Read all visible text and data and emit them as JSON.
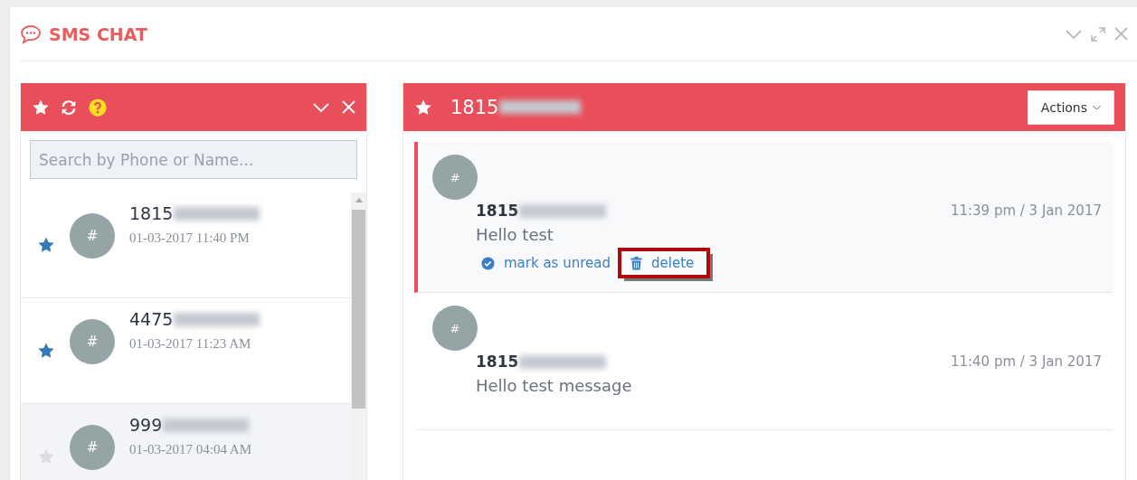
{
  "window": {
    "title": "SMS CHAT"
  },
  "contacts_panel": {
    "search": {
      "placeholder": "Search by Phone or Name..."
    },
    "conversations": [
      {
        "avatar": "#",
        "number": "1815",
        "time": "01-03-2017 11:40 PM",
        "starred": true,
        "selected": false
      },
      {
        "avatar": "#",
        "number": "4475",
        "time": "01-03-2017 11:23 AM",
        "starred": true,
        "selected": false
      },
      {
        "avatar": "#",
        "number": "999",
        "time": "01-03-2017 04:04 AM",
        "starred": false,
        "selected": true
      }
    ]
  },
  "chat_panel": {
    "number": "1815",
    "actions_button": "Actions",
    "messages": [
      {
        "avatar": "#",
        "sender": "1815",
        "time": "11:39 pm / 3 Jan 2017",
        "text": "Hello test",
        "highlighted": true,
        "actions": [
          {
            "kind": "check",
            "label": "mark as unread",
            "annotated": false
          },
          {
            "kind": "trash",
            "label": "delete",
            "annotated": true
          }
        ]
      },
      {
        "avatar": "#",
        "sender": "1815",
        "time": "11:40 pm / 3 Jan 2017",
        "text": "Hello test message",
        "highlighted": false
      }
    ]
  }
}
